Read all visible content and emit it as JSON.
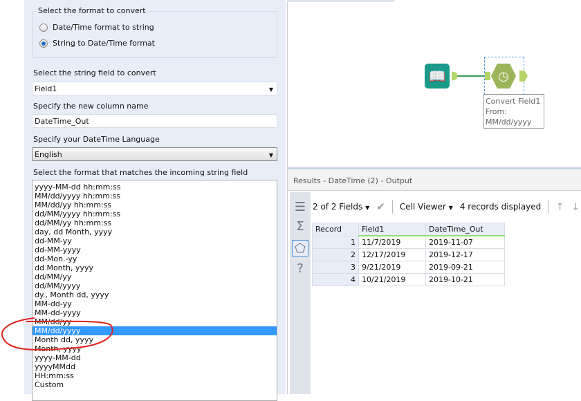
{
  "config": {
    "format_group_label": "Select the format to convert",
    "radio_options": [
      {
        "label": "Date/Time format to string",
        "checked": false
      },
      {
        "label": "String to Date/Time format",
        "checked": true
      }
    ],
    "string_field_label": "Select the string field to convert",
    "string_field_value": "Field1",
    "column_name_label": "Specify the new column name",
    "column_name_value": "DateTime_Out",
    "language_label": "Specify your DateTime Language",
    "language_value": "English",
    "format_list_label": "Select the format that matches the incoming string field",
    "formats": [
      "yyyy-MM-dd hh:mm:ss",
      "MM/dd/yyyy hh:mm:ss",
      "MM/dd/yy hh:mm:ss",
      "dd/MM/yyyy hh:mm:ss",
      "dd/MM/yy hh:mm:ss",
      "day, dd Month, yyyy",
      "dd-MM-yy",
      "dd-MM-yyyy",
      "dd-Mon.-yy",
      "dd Month, yyyy",
      "dd/MM/yy",
      "dd/MM/yyyy",
      "dy., Month dd, yyyy",
      "MM-dd-yy",
      "MM-dd-yyyy",
      "MM/dd/yy",
      "MM/dd/yyyy",
      "Month dd, yyyy",
      "Month, yyyy",
      "yyyy-MM-dd",
      "yyyyMMdd",
      "HH:mm:ss",
      "Custom"
    ],
    "selected_format": "MM/dd/yyyy"
  },
  "canvas": {
    "tool_annotation": [
      "Convert Field1",
      "From:",
      "MM/dd/yyyy"
    ],
    "input_tool_color": "#1a9a8a",
    "datetime_tool_color": "#9cb45a"
  },
  "results": {
    "title": "Results - DateTime (2) - Output",
    "fields_label": "2 of 2 Fields",
    "viewer_label": "Cell Viewer",
    "records_label": "4 records displayed",
    "columns": [
      "Record",
      "Field1",
      "DateTime_Out"
    ],
    "rows": [
      [
        "1",
        "11/7/2019",
        "2019-11-07"
      ],
      [
        "2",
        "12/17/2019",
        "2019-12-17"
      ],
      [
        "3",
        "9/21/2019",
        "2019-09-21"
      ],
      [
        "4",
        "10/21/2019",
        "2019-10-21"
      ]
    ]
  }
}
